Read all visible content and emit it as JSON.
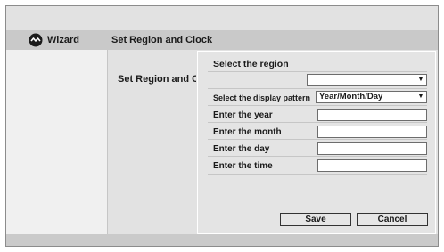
{
  "header": {
    "wizard_label": "Wizard",
    "title": "Set Region and Clock",
    "logo_icon": "wizard-logo-icon"
  },
  "content": {
    "title": "Set Region and Clock"
  },
  "dialog": {
    "region_heading": "Select the region",
    "region_value": "",
    "pattern_label": "Select the display pattern",
    "pattern_value": "Year/Month/Day",
    "dropdown_icon": "triangle-down",
    "year_label": "Enter the year",
    "month_label": "Enter the month",
    "day_label": "Enter the day",
    "time_label": "Enter the time",
    "year_value": "",
    "month_value": "",
    "day_value": "",
    "time_value": "",
    "save_label": "Save",
    "cancel_label": "Cancel"
  }
}
